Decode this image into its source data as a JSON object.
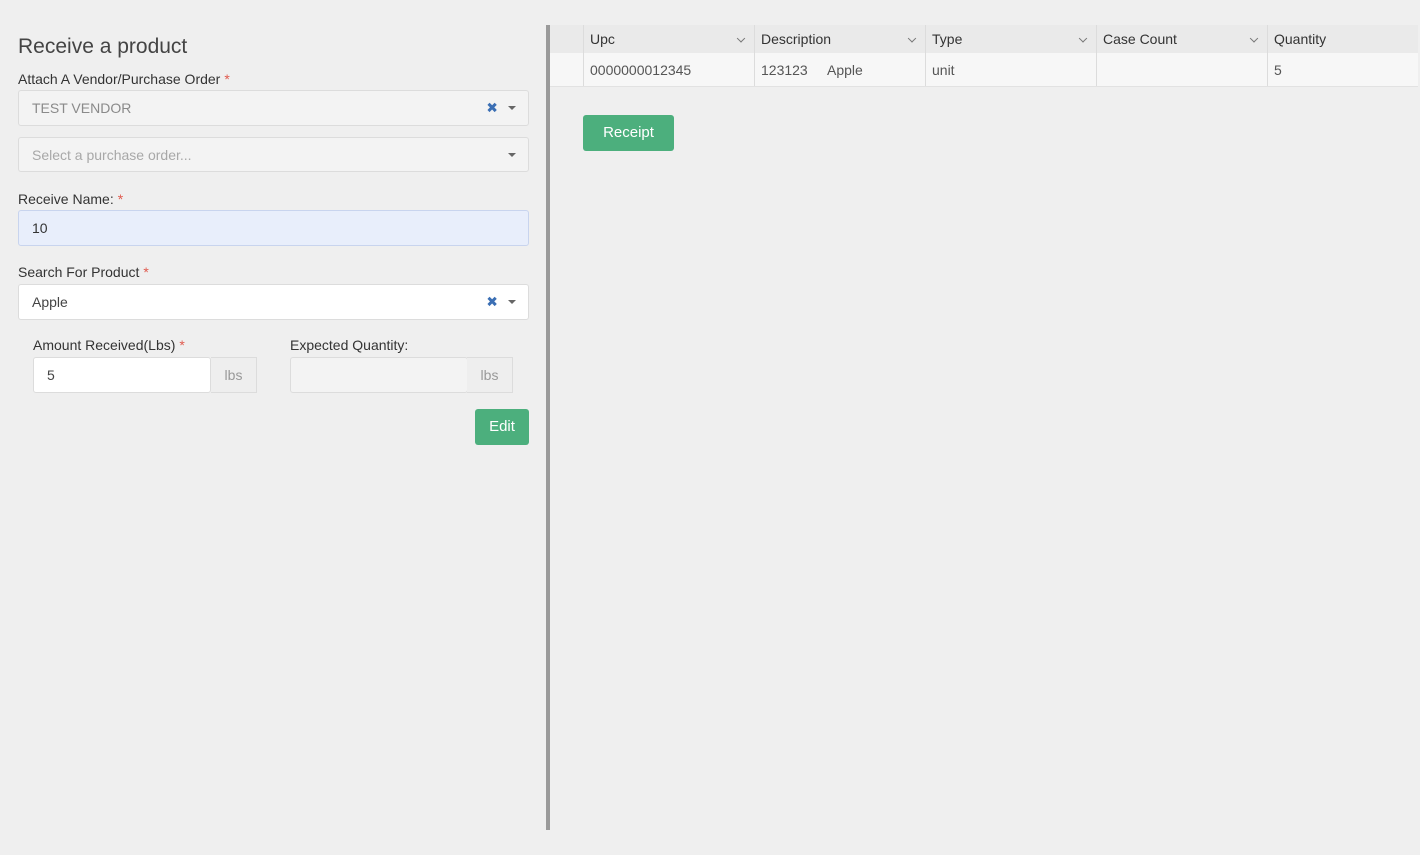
{
  "form": {
    "title": "Receive a product",
    "vendor_label": "Attach A Vendor/Purchase Order",
    "required_mark": "*",
    "vendor_value": "TEST VENDOR",
    "po_placeholder": "Select a purchase order...",
    "receive_name_label": "Receive Name:",
    "receive_name_value": "10",
    "product_label": "Search For Product",
    "product_value": "Apple",
    "amount_label": "Amount Received(Lbs)",
    "amount_value": "5",
    "amount_unit": "lbs",
    "expected_label": "Expected Quantity:",
    "expected_value": "",
    "expected_unit": "lbs",
    "edit_label": "Edit",
    "clear_glyph": "✖"
  },
  "grid": {
    "columns": [
      "Upc",
      "Description",
      "Type",
      "Case Count",
      "Quantity"
    ],
    "row": {
      "upc": "0000000012345",
      "desc_code": "123123",
      "desc_name": "Apple",
      "type": "unit",
      "case_count": "",
      "quantity": "5"
    }
  },
  "receipt_label": "Receipt",
  "colors": {
    "accent": "#4caf7d",
    "required": "#e05a4e",
    "clear_icon": "#3b6fb4"
  }
}
